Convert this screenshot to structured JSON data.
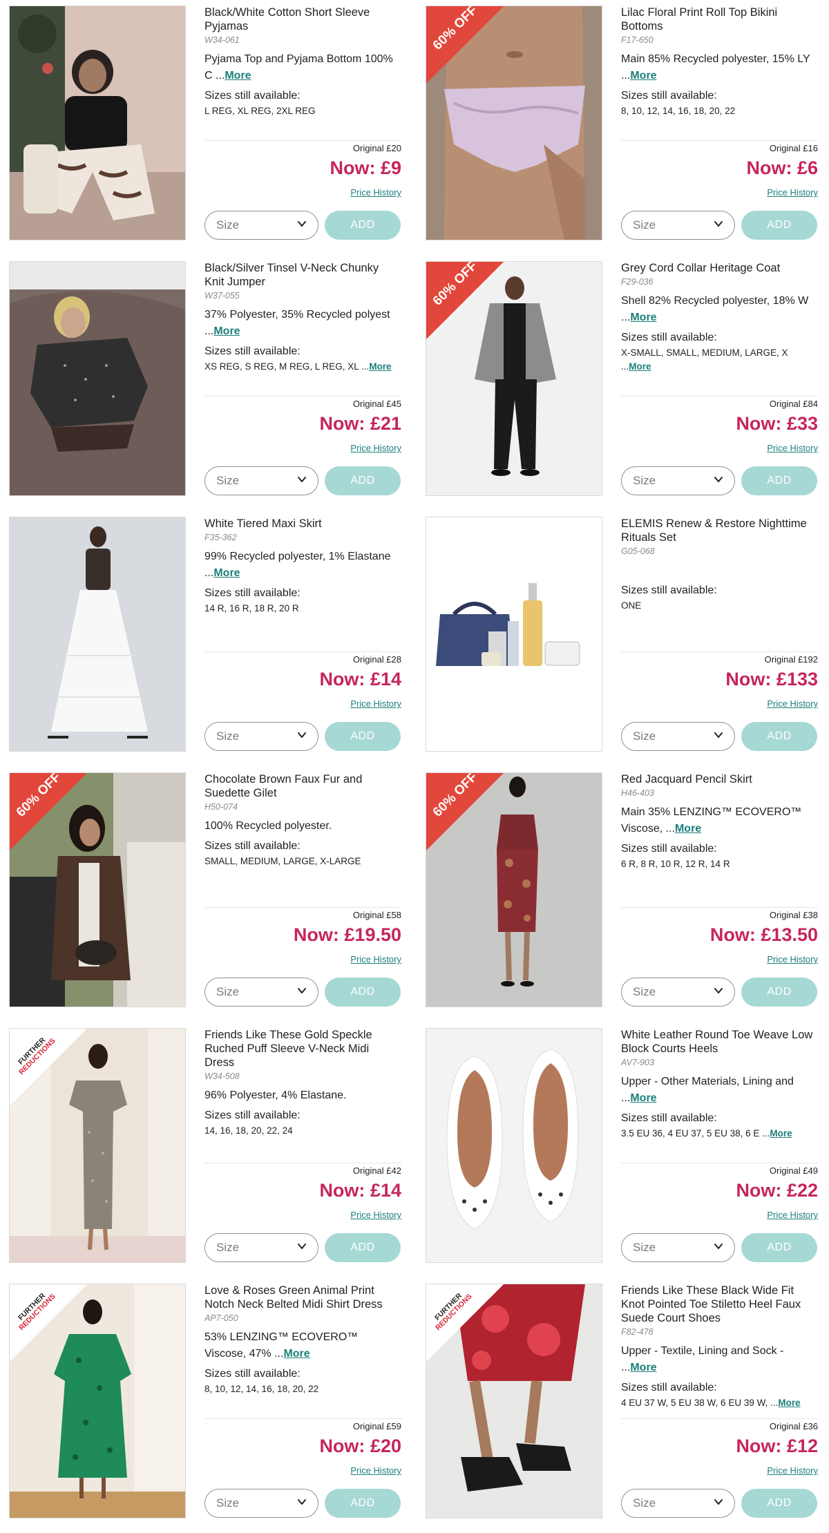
{
  "common": {
    "original_prefix": "Original ",
    "now_prefix": "Now: ",
    "price_history": "Price History",
    "size_placeholder": "Size",
    "add_label": "ADD",
    "sizes_label": "Sizes still available:",
    "more_label": "More",
    "offer_badge": "60% OFF",
    "further_badge_line1": "FURTHER",
    "further_badge_line2": "REDUCTIONS"
  },
  "products": [
    {
      "title": "Black/White Cotton Short Sleeve Pyjamas",
      "code": "W34-061",
      "desc": "Pyjama Top and Pyjama Bottom 100% C ...",
      "desc_more": true,
      "sizes": "L REG, XL REG, 2XL REG",
      "sizes_more": false,
      "original": "£20",
      "now": "£9",
      "badge": "none",
      "image": "pyjamas-photo"
    },
    {
      "title": "Lilac Floral Print Roll Top Bikini Bottoms",
      "code": "F17-650",
      "desc": "Main 85% Recycled polyester, 15% LY ...",
      "desc_more": true,
      "sizes": "8, 10, 12, 14, 16, 18, 20, 22",
      "sizes_more": false,
      "original": "£16",
      "now": "£6",
      "badge": "offer",
      "image": "bikini-photo"
    },
    {
      "title": "Black/Silver Tinsel V-Neck Chunky Knit Jumper",
      "code": "W37-055",
      "desc": "37% Polyester, 35% Recycled polyest ...",
      "desc_more": true,
      "sizes": "XS REG, S REG, M REG, L REG, XL ...",
      "sizes_more": true,
      "original": "£45",
      "now": "£21",
      "badge": "none",
      "image": "jumper-photo"
    },
    {
      "title": "Grey Cord Collar Heritage Coat",
      "code": "F29-036",
      "desc": "Shell 82% Recycled polyester, 18% W ...",
      "desc_more": true,
      "sizes": "X-SMALL, SMALL, MEDIUM, LARGE, X ...",
      "sizes_more": true,
      "original": "£84",
      "now": "£33",
      "badge": "offer",
      "image": "coat-photo"
    },
    {
      "title": "White Tiered Maxi Skirt",
      "code": "F35-362",
      "desc": "99% Recycled polyester, 1% Elastane ...",
      "desc_more": true,
      "sizes": "14 R, 16 R, 18 R, 20 R",
      "sizes_more": false,
      "original": "£28",
      "now": "£14",
      "badge": "none",
      "image": "skirt-photo"
    },
    {
      "title": "ELEMIS Renew & Restore Nighttime Rituals Set",
      "code": "G05-068",
      "desc": "",
      "desc_more": false,
      "sizes": "ONE",
      "sizes_more": false,
      "original": "£192",
      "now": "£133",
      "badge": "none",
      "image": "elemis-set-photo"
    },
    {
      "title": "Chocolate Brown Faux Fur and Suedette Gilet",
      "code": "H50-074",
      "desc": "100% Recycled polyester.",
      "desc_more": false,
      "sizes": "SMALL, MEDIUM, LARGE, X-LARGE",
      "sizes_more": false,
      "original": "£58",
      "now": "£19.50",
      "badge": "offer",
      "image": "gilet-photo"
    },
    {
      "title": "Red Jacquard Pencil Skirt",
      "code": "H46-403",
      "desc": "Main 35% LENZING™ ECOVERO™ Viscose, ...",
      "desc_more": true,
      "sizes": "6 R, 8 R, 10 R, 12 R, 14 R",
      "sizes_more": false,
      "original": "£38",
      "now": "£13.50",
      "badge": "offer",
      "image": "pencil-skirt-photo"
    },
    {
      "title": "Friends Like These Gold Speckle Ruched Puff Sleeve V-Neck Midi Dress",
      "code": "W34-508",
      "desc": "96% Polyester, 4% Elastane.",
      "desc_more": false,
      "sizes": "14, 16, 18, 20, 22, 24",
      "sizes_more": false,
      "original": "£42",
      "now": "£14",
      "badge": "further",
      "image": "midi-dress-photo"
    },
    {
      "title": "White Leather Round Toe Weave Low Block Courts Heels",
      "code": "AV7-903",
      "desc": "Upper - Other Materials, Lining and ...",
      "desc_more": true,
      "sizes": "3.5 EU 36, 4 EU 37, 5 EU 38, 6 E ...",
      "sizes_more": true,
      "original": "£49",
      "now": "£22",
      "badge": "none",
      "image": "courts-photo"
    },
    {
      "title": "Love & Roses Green Animal Print Notch Neck Belted Midi Shirt Dress",
      "code": "AP7-050",
      "desc": "53% LENZING™ ECOVERO™ Viscose, 47% ...",
      "desc_more": true,
      "sizes": "8, 10, 12, 14, 16, 18, 20, 22",
      "sizes_more": false,
      "original": "£59",
      "now": "£20",
      "badge": "further",
      "image": "shirt-dress-photo"
    },
    {
      "title": "Friends Like These Black Wide Fit Knot Pointed Toe Stiletto Heel Faux Suede Court Shoes",
      "code": "F82-478",
      "desc": "Upper - Textile, Lining and Sock - ...",
      "desc_more": true,
      "sizes": "4 EU 37 W, 5 EU 38 W, 6 EU 39 W, ...",
      "sizes_more": true,
      "original": "£36",
      "now": "£12",
      "badge": "further",
      "image": "stiletto-photo"
    }
  ]
}
